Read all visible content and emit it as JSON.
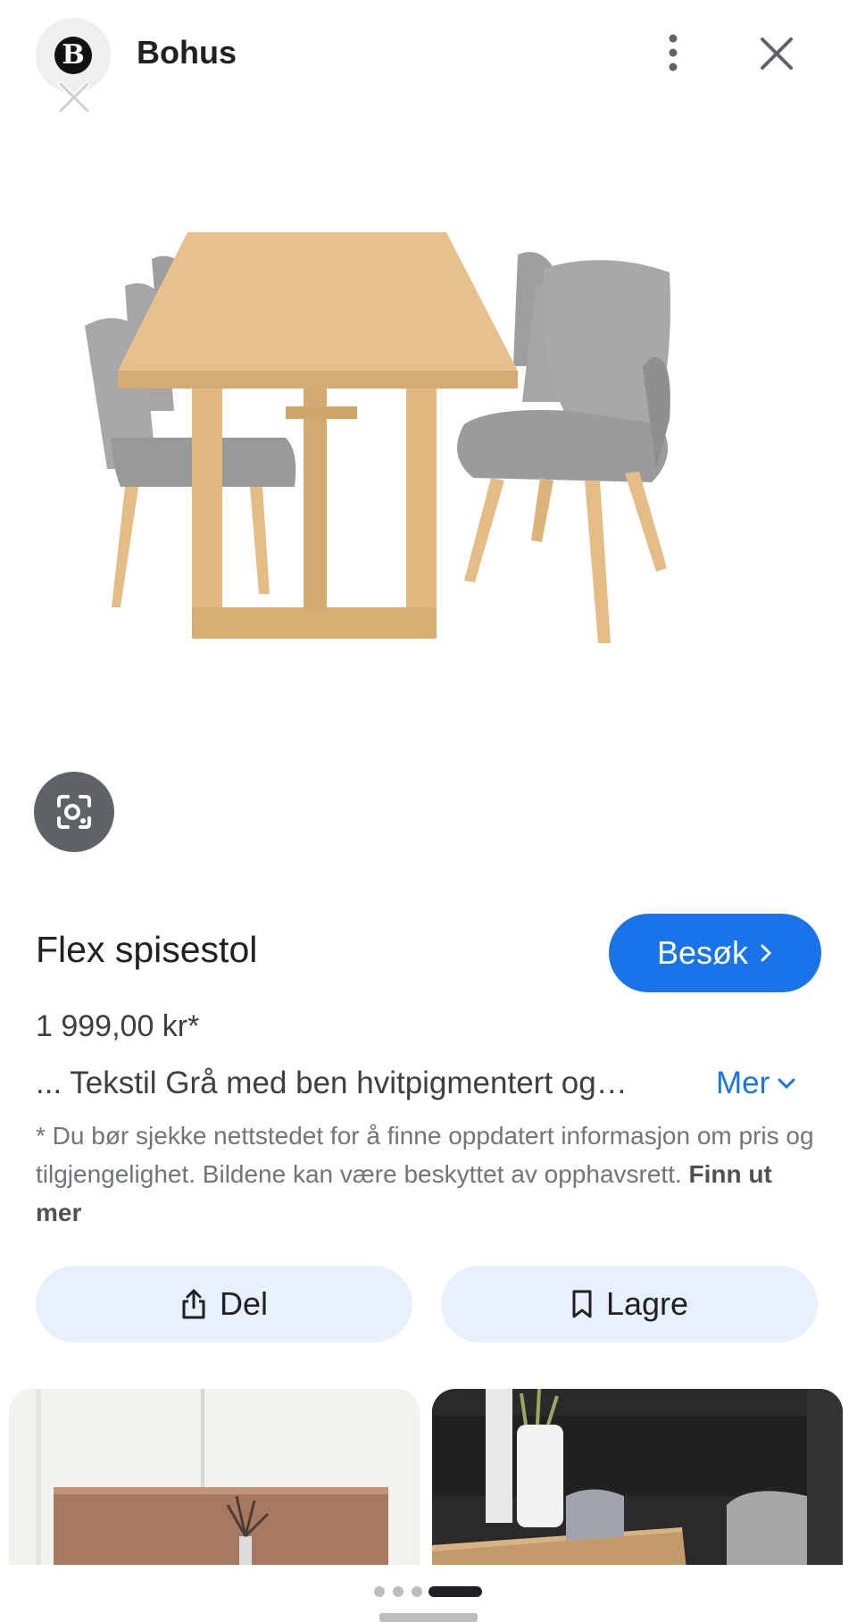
{
  "header": {
    "logo_letter": "B",
    "site_name": "Bohus"
  },
  "product": {
    "title": "Flex spisestol",
    "visit_label": "Besøk",
    "price": "1 999,00 kr*",
    "description": "... Tekstil Grå med ben hvitpigmentert og…",
    "more_label": "Mer",
    "disclaimer": "* Du bør sjekke nettstedet for å finne oppdatert informasjon om pris og tilgjengelighet. Bildene kan være beskyttet av opphavsrett.",
    "learn_more": "Finn ut mer"
  },
  "actions": {
    "share_label": "Del",
    "save_label": "Lagre"
  },
  "icons": {
    "close": "close-icon",
    "more": "more-vert-icon",
    "lens": "lens-icon",
    "share": "share-icon",
    "save": "bookmark-icon",
    "chevron_right": "chevron-right-icon",
    "chevron_down": "chevron-down-icon"
  },
  "colors": {
    "accent": "#1a73e8",
    "action_bg": "#e8f0fe",
    "wood": "#e3bd85",
    "fabric": "#a9a9a9"
  },
  "pagination": {
    "count": 4,
    "active": 4
  }
}
